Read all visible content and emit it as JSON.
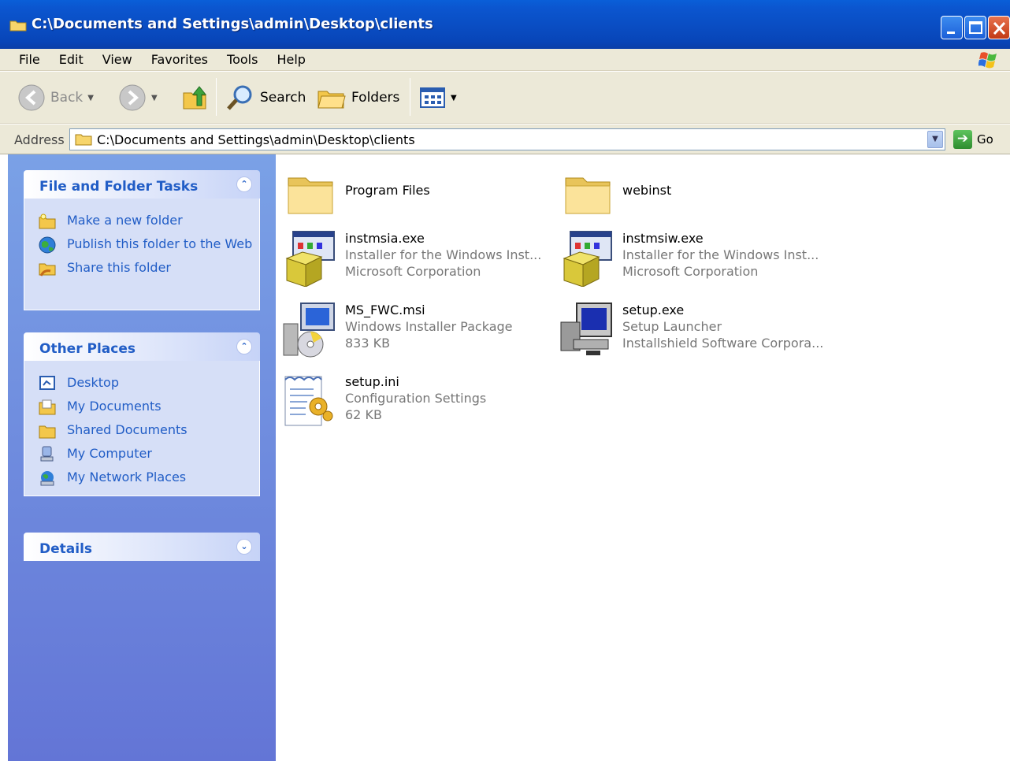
{
  "window": {
    "title": "C:\\Documents and Settings\\admin\\Desktop\\clients"
  },
  "menu": [
    "File",
    "Edit",
    "View",
    "Favorites",
    "Tools",
    "Help"
  ],
  "toolbar": {
    "back": "Back",
    "search": "Search",
    "folders": "Folders"
  },
  "address": {
    "label": "Address",
    "value": "C:\\Documents and Settings\\admin\\Desktop\\clients",
    "go": "Go"
  },
  "left_pane": {
    "file_tasks": {
      "title": "File and Folder Tasks",
      "items": [
        "Make a new folder",
        "Publish this folder to the Web",
        "Share this folder"
      ]
    },
    "other_places": {
      "title": "Other Places",
      "items": [
        "Desktop",
        "My Documents",
        "Shared Documents",
        "My Computer",
        "My Network Places"
      ]
    },
    "details": {
      "title": "Details"
    }
  },
  "files": [
    {
      "name": "Program Files",
      "line2": "",
      "line3": "",
      "icon": "folder-icon"
    },
    {
      "name": "webinst",
      "line2": "",
      "line3": "",
      "icon": "folder-icon"
    },
    {
      "name": "instmsia.exe",
      "line2": "Installer for the Windows Inst...",
      "line3": "Microsoft Corporation",
      "icon": "installer-icon"
    },
    {
      "name": "instmsiw.exe",
      "line2": "Installer for the Windows Inst...",
      "line3": "Microsoft Corporation",
      "icon": "installer-icon"
    },
    {
      "name": "MS_FWC.msi",
      "line2": "Windows Installer Package",
      "line3": "833 KB",
      "icon": "msi-package-icon"
    },
    {
      "name": "setup.exe",
      "line2": "Setup Launcher",
      "line3": "Installshield Software Corpora...",
      "icon": "setup-launcher-icon"
    },
    {
      "name": "setup.ini",
      "line2": "Configuration Settings",
      "line3": "62 KB",
      "icon": "config-file-icon"
    }
  ]
}
